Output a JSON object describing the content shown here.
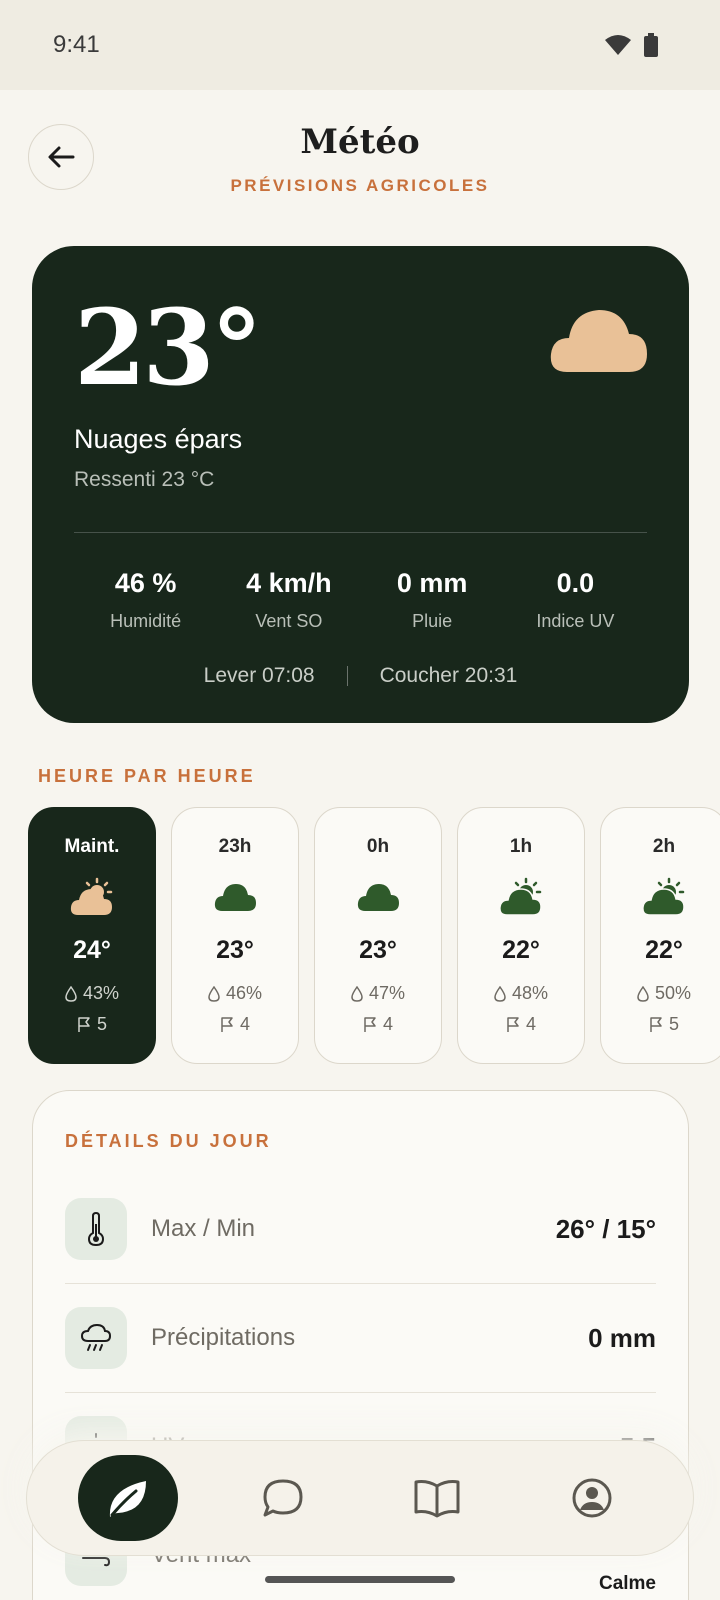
{
  "status_bar": {
    "time": "9:41"
  },
  "header": {
    "title": "Météo",
    "subtitle": "PRÉVISIONS AGRICOLES"
  },
  "current": {
    "temperature": "23°",
    "condition": "Nuages épars",
    "feels_like": "Ressenti 23 °C",
    "stats": [
      {
        "value": "46 %",
        "label": "Humidité"
      },
      {
        "value": "4 km/h",
        "label": "Vent SO"
      },
      {
        "value": "0 mm",
        "label": "Pluie"
      },
      {
        "value": "0.0",
        "label": "Indice UV"
      }
    ],
    "sunrise": "Lever 07:08",
    "sunset": "Coucher 20:31",
    "icon": "cloud-icon"
  },
  "hourly": {
    "title": "HEURE PAR HEURE",
    "items": [
      {
        "label": "Maint.",
        "temp": "24°",
        "humidity": "43%",
        "wind": "5",
        "icon": "partly-cloudy-icon"
      },
      {
        "label": "23h",
        "temp": "23°",
        "humidity": "46%",
        "wind": "4",
        "icon": "cloud-icon"
      },
      {
        "label": "0h",
        "temp": "23°",
        "humidity": "47%",
        "wind": "4",
        "icon": "cloud-icon"
      },
      {
        "label": "1h",
        "temp": "22°",
        "humidity": "48%",
        "wind": "4",
        "icon": "partly-cloudy-icon"
      },
      {
        "label": "2h",
        "temp": "22°",
        "humidity": "50%",
        "wind": "5",
        "icon": "partly-cloudy-icon"
      }
    ]
  },
  "details": {
    "title": "DÉTAILS DU JOUR",
    "rows": [
      {
        "label": "Max / Min",
        "value": "26° / 15°",
        "icon": "thermometer-icon"
      },
      {
        "label": "Précipitations",
        "value": "0 mm",
        "icon": "rain-cloud-icon"
      },
      {
        "label": "UV",
        "value": "5.5",
        "icon": "sun-icon"
      },
      {
        "label": "Vent max",
        "value": "Calme",
        "icon": "wind-icon"
      }
    ]
  },
  "nav": {
    "items": [
      {
        "name": "leaf-icon",
        "active": true
      },
      {
        "name": "chat-icon",
        "active": false
      },
      {
        "name": "book-icon",
        "active": false
      },
      {
        "name": "profile-icon",
        "active": false
      }
    ]
  },
  "colors": {
    "background": "#f7f5ef",
    "dark_green": "#18271b",
    "accent_orange": "#c8713c",
    "icon_green": "#2f5a2b",
    "cloud_peach": "#e9c197"
  }
}
